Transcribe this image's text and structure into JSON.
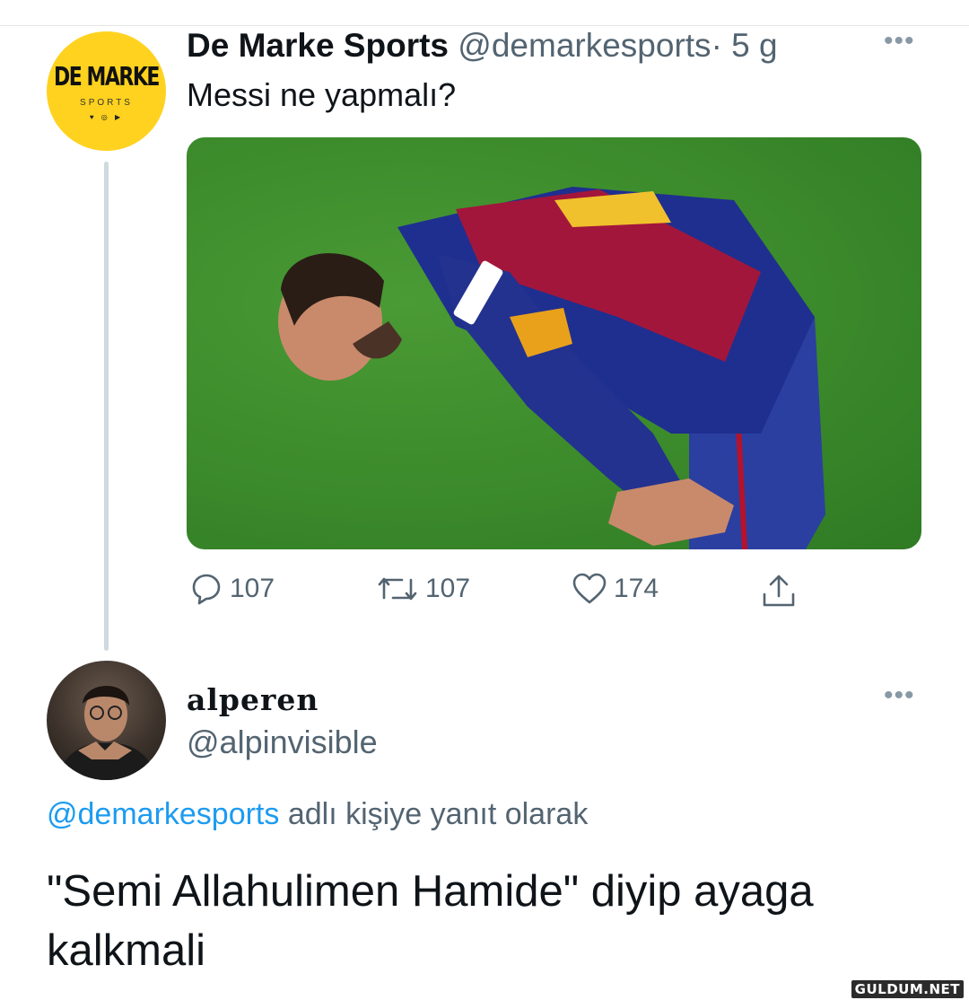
{
  "tweet": {
    "author": {
      "name": "De Marke Sports",
      "handle": "@demarkesports",
      "separator": "·",
      "time": "5 g",
      "avatar": {
        "brand": "DE MARKE",
        "sub": "SPORTS",
        "icons": "♥ ◎ ▶"
      }
    },
    "more": "•••",
    "text": "Messi ne yapmalı?",
    "actions": {
      "reply_count": "107",
      "retweet_count": "107",
      "like_count": "174"
    }
  },
  "reply": {
    "author": {
      "name": "alperen",
      "handle": "@alpinvisible"
    },
    "more": "•••",
    "replying_to": {
      "mention": "@demarkesports",
      "suffix": " adlı kişiye yanıt olarak"
    },
    "text": "\"Semi Allahulimen Hamide\" diyip ayaga kalkmali"
  },
  "watermark": "GULDUM.NET",
  "colors": {
    "accent": "#1d9bf0",
    "muted": "#536471",
    "avatar_bg": "#ffd21f"
  }
}
